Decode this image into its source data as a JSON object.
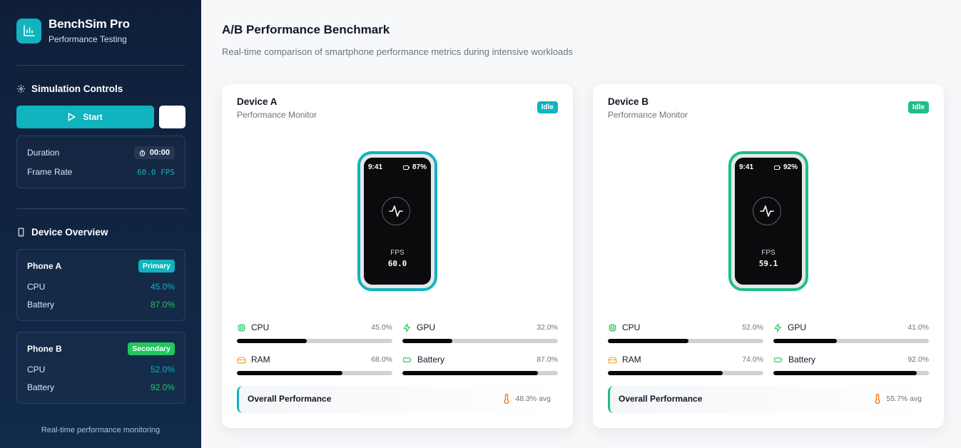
{
  "app": {
    "title": "BenchSim Pro",
    "subtitle": "Performance Testing",
    "icon": "bar-chart-icon",
    "accent": "#10b3be"
  },
  "sidebar": {
    "controls_title": "Simulation Controls",
    "start_label": "Start",
    "duration_label": "Duration",
    "duration_value": "00:00",
    "framerate_label": "Frame Rate",
    "framerate_value": "60.0 FPS",
    "overview_title": "Device Overview",
    "phones": [
      {
        "name": "Phone A",
        "badge": "Primary",
        "badge_color": "#10b3be",
        "cpu_label": "CPU",
        "cpu": "45.0%",
        "battery_label": "Battery",
        "battery": "87.0%"
      },
      {
        "name": "Phone B",
        "badge": "Secondary",
        "badge_color": "#22c55e",
        "cpu_label": "CPU",
        "cpu": "52.0%",
        "battery_label": "Battery",
        "battery": "92.0%"
      }
    ],
    "footer": "Real-time performance monitoring"
  },
  "main": {
    "title": "A/B Performance Benchmark",
    "subtitle": "Real-time comparison of smartphone performance metrics during intensive workloads"
  },
  "devices": [
    {
      "title": "Device A",
      "subtitle": "Performance Monitor",
      "status": "Idle",
      "color": "#10b3be",
      "time": "9:41",
      "battery_pct": "87%",
      "fps_label": "FPS",
      "fps": "60.0",
      "metrics": {
        "cpu": {
          "label": "CPU",
          "text": "45.0%",
          "value": 0.45
        },
        "gpu": {
          "label": "GPU",
          "text": "32.0%",
          "value": 0.32
        },
        "ram": {
          "label": "RAM",
          "text": "68.0%",
          "value": 0.68
        },
        "battery": {
          "label": "Battery",
          "text": "87.0%",
          "value": 0.87
        }
      },
      "overall_label": "Overall Performance",
      "overall_value": "48.3% avg"
    },
    {
      "title": "Device B",
      "subtitle": "Performance Monitor",
      "status": "Idle",
      "color": "#1dbf84",
      "time": "9:41",
      "battery_pct": "92%",
      "fps_label": "FPS",
      "fps": "59.1",
      "metrics": {
        "cpu": {
          "label": "CPU",
          "text": "52.0%",
          "value": 0.52
        },
        "gpu": {
          "label": "GPU",
          "text": "41.0%",
          "value": 0.41
        },
        "ram": {
          "label": "RAM",
          "text": "74.0%",
          "value": 0.74
        },
        "battery": {
          "label": "Battery",
          "text": "92.0%",
          "value": 0.92
        }
      },
      "overall_label": "Overall Performance",
      "overall_value": "55.7% avg"
    }
  ]
}
